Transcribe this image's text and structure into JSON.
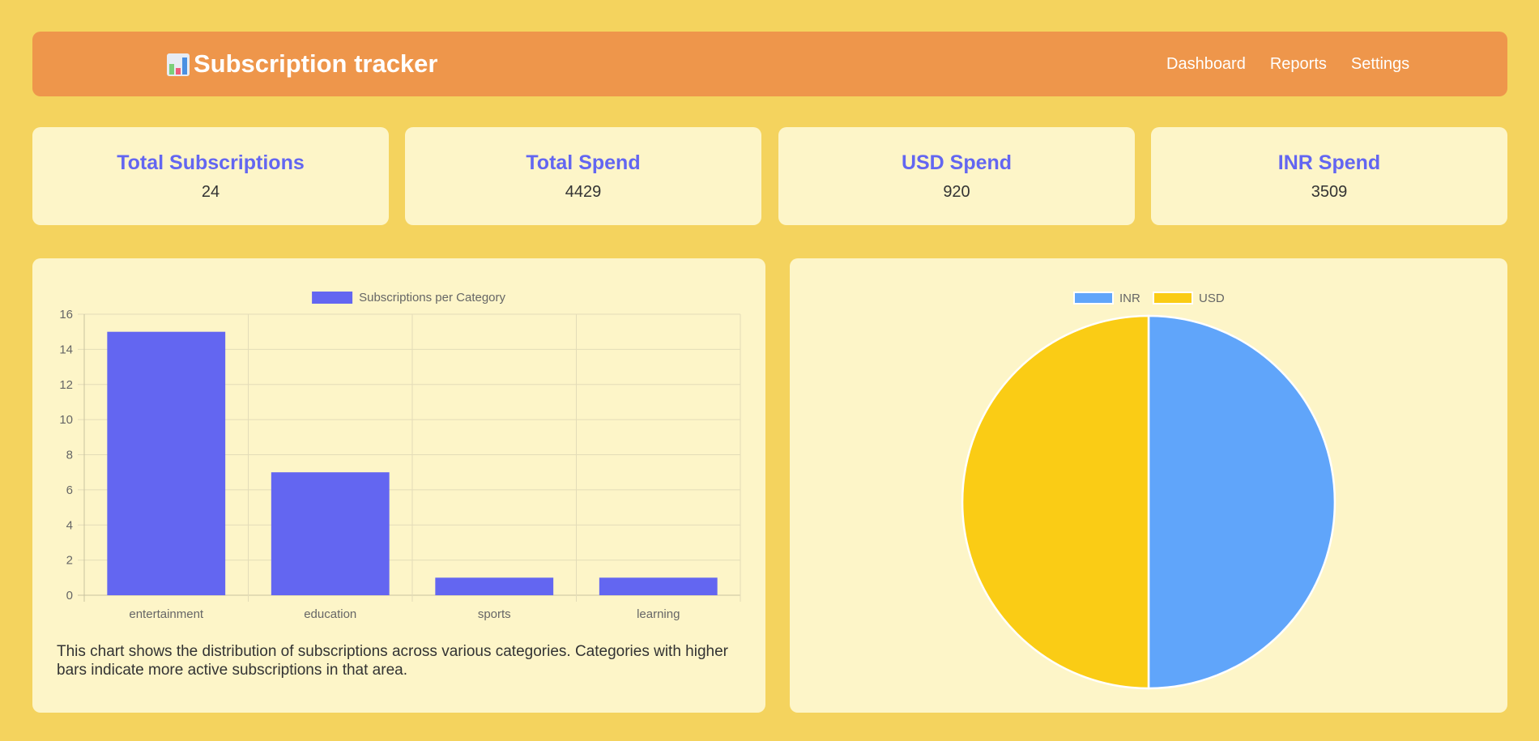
{
  "header": {
    "icon": "bar-chart-emoji-icon",
    "title": "Subscription tracker",
    "nav": [
      "Dashboard",
      "Reports",
      "Settings"
    ]
  },
  "stats": [
    {
      "title": "Total Subscriptions",
      "value": "24"
    },
    {
      "title": "Total Spend",
      "value": "4429"
    },
    {
      "title": "USD Spend",
      "value": "920"
    },
    {
      "title": "INR Spend",
      "value": "3509"
    }
  ],
  "colors": {
    "background": "#f4d35e",
    "header": "#ee964b",
    "card": "#fdf5c8",
    "accent": "#6366f1",
    "inr": "#60a5fa",
    "usd": "#facc15"
  },
  "bar_panel": {
    "caption": "This chart shows the distribution of subscriptions across various categories. Categories with higher bars indicate more active subscriptions in that area."
  },
  "chart_data": [
    {
      "type": "bar",
      "categories": [
        "entertainment",
        "education",
        "sports",
        "learning"
      ],
      "series": [
        {
          "name": "Subscriptions per Category",
          "values": [
            15,
            7,
            1,
            1
          ],
          "color": "#6366f1"
        }
      ],
      "ylim": [
        0,
        16
      ],
      "yticks": [
        0,
        2,
        4,
        6,
        8,
        10,
        12,
        14,
        16
      ],
      "grid": true,
      "legend": "top"
    },
    {
      "type": "pie",
      "labels": [
        "INR",
        "USD"
      ],
      "values": [
        0.5,
        0.5
      ],
      "colors": [
        "#60a5fa",
        "#facc15"
      ],
      "legend": "top"
    }
  ]
}
